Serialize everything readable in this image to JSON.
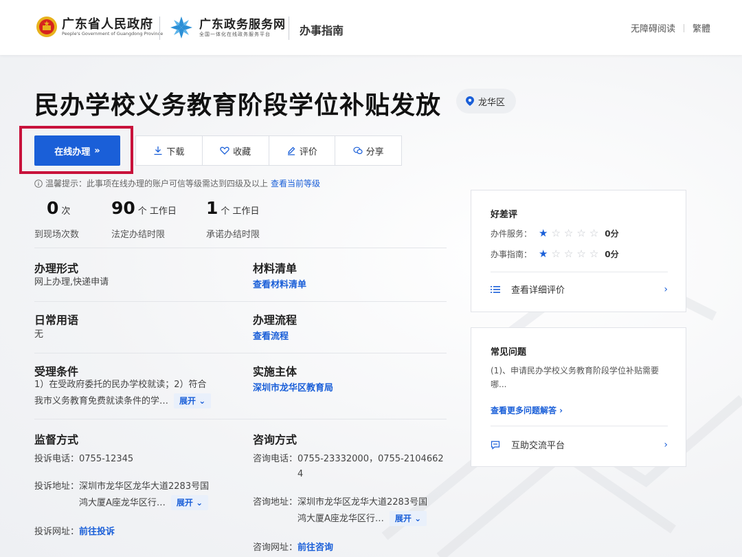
{
  "header": {
    "gov_name": "广东省人民政府",
    "gov_name_en": "People's Government of Guangdong Province",
    "portal_name": "广东政务服务网",
    "portal_sub": "全国一体化在线政务服务平台",
    "section": "办事指南",
    "accessibility": "无障碍阅读",
    "traditional": "繁體"
  },
  "page": {
    "title": "民办学校义务教育阶段学位补贴发放",
    "region": "龙华区"
  },
  "actions": {
    "online": "在线办理",
    "online_arrow": "»",
    "download": "下载",
    "favorite": "收藏",
    "review": "评价",
    "share": "分享"
  },
  "tip": {
    "text": "温馨提示：此事项在线办理的账户可信等级需达到四级及以上",
    "link": "查看当前等级"
  },
  "stats": [
    {
      "num": "0",
      "unit": "次",
      "label": "到现场次数"
    },
    {
      "num": "90",
      "unit": "个 工作日",
      "label": "法定办结时限"
    },
    {
      "num": "1",
      "unit": "个 工作日",
      "label": "承诺办结时限"
    }
  ],
  "details": {
    "mode_title": "办理形式",
    "mode_value": "网上办理,快递申请",
    "materials_title": "材料清单",
    "materials_link": "查看材料清单",
    "daily_title": "日常用语",
    "daily_value": "无",
    "flow_title": "办理流程",
    "flow_link": "查看流程",
    "condition_title": "受理条件",
    "condition_line1": "1）在受政府委托的民办学校就读；2）符合",
    "condition_line2": "我市义务教育免费就读条件的学…",
    "expand": "展开 ⌄",
    "subject_title": "实施主体",
    "subject_link": "深圳市龙华区教育局",
    "supervise_title": "监督方式",
    "complaint_phone": "投诉电话：0755-12345",
    "complaint_addr_label": "投诉地址：",
    "complaint_addr_line1": "深圳市龙华区龙华大道2283号国",
    "complaint_addr_line2": "鸿大厦A座龙华区行…",
    "complaint_web_label": "投诉网址：",
    "complaint_web_link": "前往投诉",
    "consult_title": "咨询方式",
    "consult_phone_label": "咨询电话：",
    "consult_phone_line1": "0755-23332000，0755-2104662",
    "consult_phone_line2": "4",
    "consult_addr_label": "咨询地址：",
    "consult_addr_line1": "深圳市龙华区龙华大道2283号国",
    "consult_addr_line2": "鸿大厦A座龙华区行…",
    "consult_web_label": "咨询网址：",
    "consult_web_link": "前往咨询"
  },
  "rating": {
    "title": "好差评",
    "service_label": "办件服务：",
    "service_score": "0分",
    "service_stars": 1,
    "guide_label": "办事指南：",
    "guide_score": "0分",
    "guide_stars": 1,
    "detail_link": "查看详细评价"
  },
  "faq": {
    "title": "常见问题",
    "q1_line1": "(1)、申请民办学校义务教育阶段学位补贴需要",
    "q1_line2": "哪...",
    "more_link": "查看更多问题解答 ›",
    "platform": "互助交流平台"
  },
  "colors": {
    "primary": "#1a5fd8",
    "highlight": "#c8123b"
  }
}
